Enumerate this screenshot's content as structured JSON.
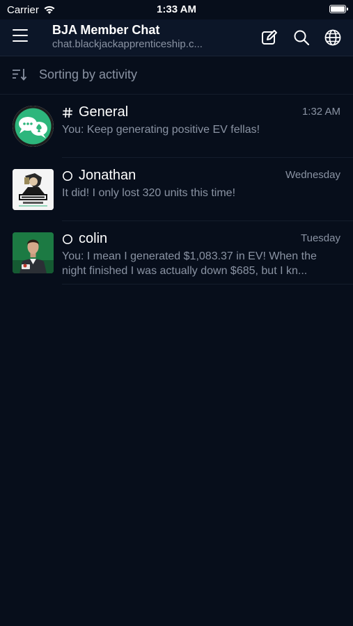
{
  "status_bar": {
    "carrier": "Carrier",
    "time": "1:33 AM"
  },
  "header": {
    "title": "BJA Member Chat",
    "subtitle": "chat.blackjackapprenticeship.c...",
    "icons": [
      "menu-icon",
      "compose-icon",
      "search-icon",
      "globe-icon"
    ]
  },
  "sort": {
    "label": "Sorting by activity",
    "icon": "sort-icon"
  },
  "chats": [
    {
      "name": "General",
      "type_icon": "hash-icon",
      "time": "1:32 AM",
      "message": "You: Keep generating positive EV fellas!"
    },
    {
      "name": "Jonathan",
      "type_icon": "status-circle-icon",
      "time": "Wednesday",
      "message": "It did! I only lost 320 units this time!"
    },
    {
      "name": "colin",
      "type_icon": "status-circle-icon",
      "time": "Tuesday",
      "message": "You: I mean I generated $1,083.37 in EV! When the night finished I was actually down $685, but I kn..."
    }
  ],
  "colors": {
    "background": "#070e1b",
    "header_bg": "#0c1628",
    "secondary_text": "#8a93a3",
    "avatar_green": "#2db67c"
  }
}
